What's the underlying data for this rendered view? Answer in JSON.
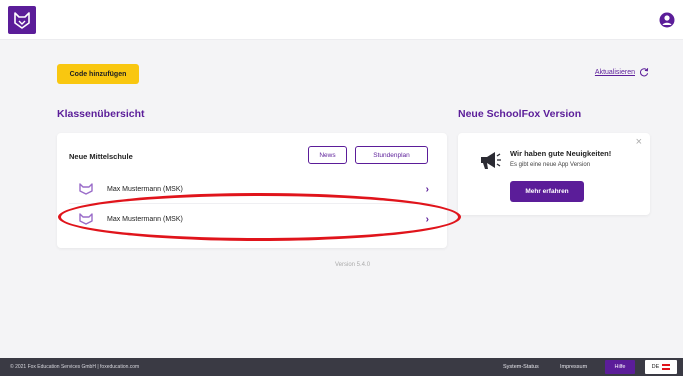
{
  "header": {
    "logo_icon": "fox-logo-icon",
    "user_icon": "user-account-icon",
    "brand_color": "#5b1d99"
  },
  "toolbar": {
    "add_code_label": "Code hinzufügen",
    "refresh_label": "Aktualisieren",
    "refresh_icon": "refresh-icon",
    "add_code_color": "#f9c710"
  },
  "class_overview": {
    "title": "Klassenübersicht",
    "school_name": "Neue Mittelschule",
    "news_label": "News",
    "timetable_label": "Stundenplan",
    "students": [
      {
        "name": "Max Mustermann (MSK)",
        "icon": "student-fox-icon"
      },
      {
        "name": "Max Mustermann (MSK)",
        "icon": "student-fox-icon"
      }
    ],
    "chevron": "›"
  },
  "version_label": "Version 5.4.0",
  "news_panel": {
    "title": "Neue SchoolFox Version",
    "close_symbol": "×",
    "headline": "Wir haben gute Neuigkeiten!",
    "subtext": "Es gibt eine neue App Version",
    "button_label": "Mehr erfahren",
    "icon": "megaphone-icon"
  },
  "annotation": {
    "color": "#e0141b"
  },
  "footer": {
    "copyright": "© 2021 Fox Education Services GmbH | foxeducation.com",
    "system_status": "System-Status",
    "impressum": "Impressum",
    "help": "Hilfe",
    "language": "DE"
  }
}
